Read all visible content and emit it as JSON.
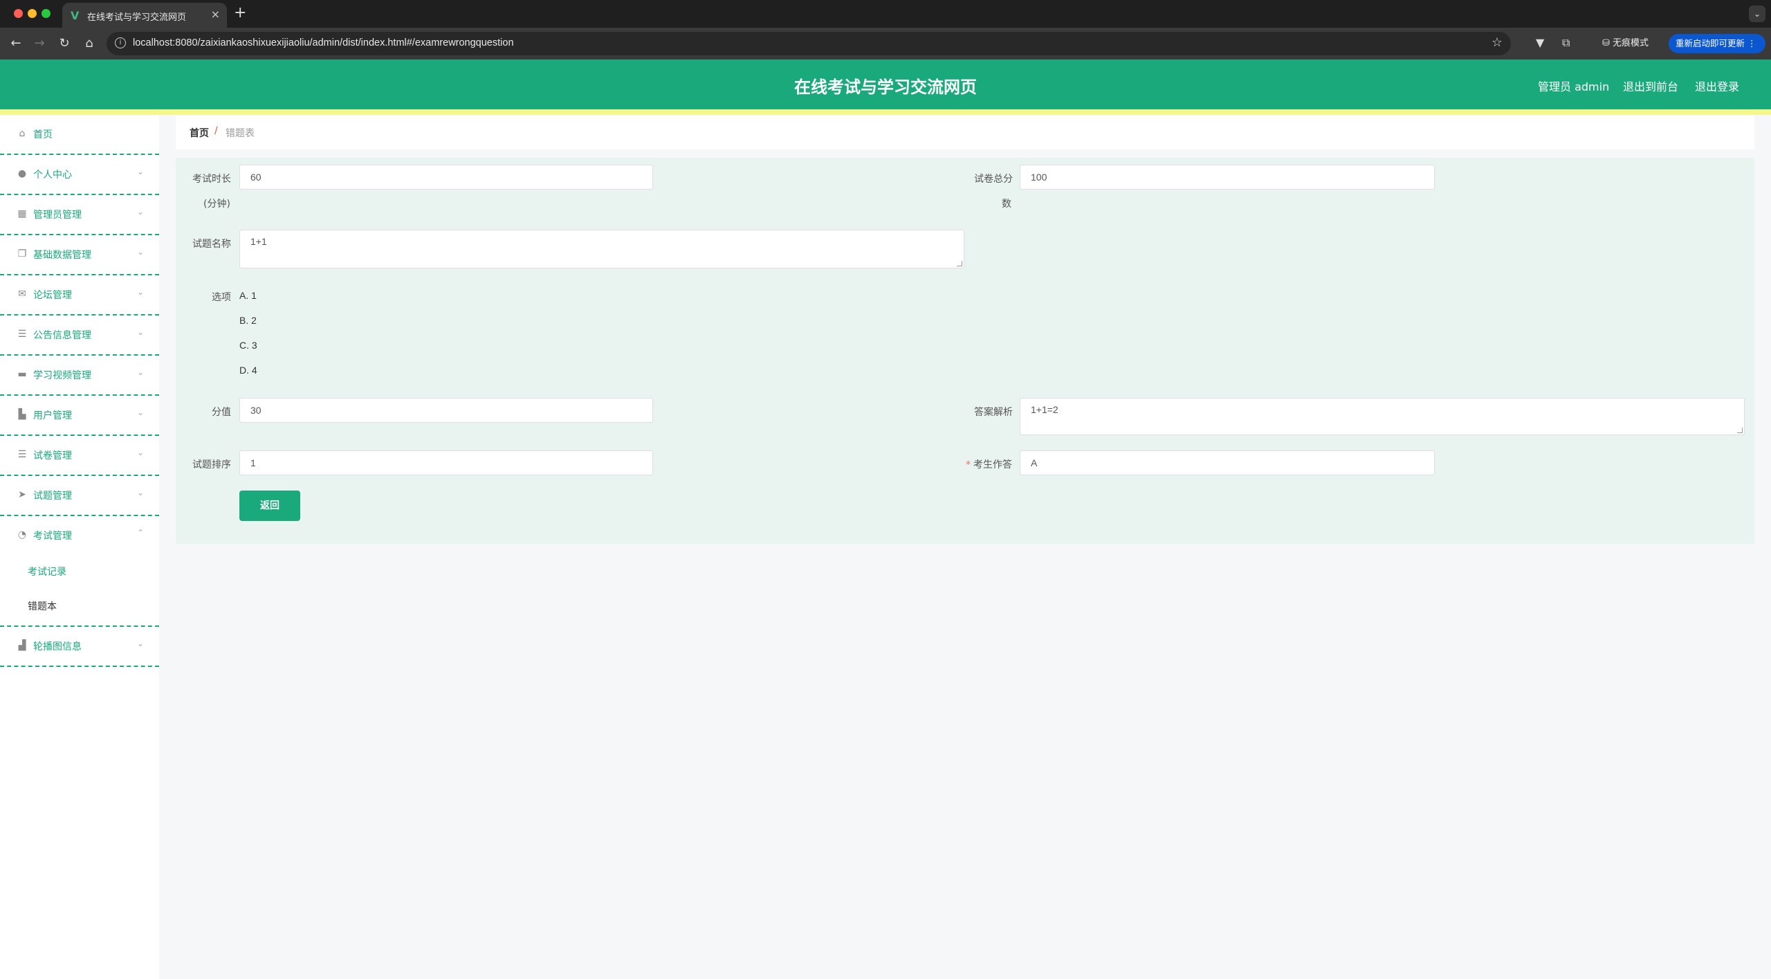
{
  "browser": {
    "tab_title": "在线考试与学习交流网页",
    "url": "localhost:8080/zaixiankaoshixuexijiaoliu/admin/dist/index.html#/examrewrongquestion",
    "incognito_label": "无痕模式",
    "update_label": "重新启动即可更新"
  },
  "header": {
    "title": "在线考试与学习交流网页",
    "user_label": "管理员 admin",
    "front_link": "退出到前台",
    "logout_link": "退出登录"
  },
  "sidebar": {
    "items": [
      {
        "label": "首页",
        "icon": "home-icon"
      },
      {
        "label": "个人中心",
        "icon": "user-icon"
      },
      {
        "label": "管理员管理",
        "icon": "grid-icon"
      },
      {
        "label": "基础数据管理",
        "icon": "copy-icon"
      },
      {
        "label": "论坛管理",
        "icon": "mail-icon"
      },
      {
        "label": "公告信息管理",
        "icon": "list-icon"
      },
      {
        "label": "学习视频管理",
        "icon": "monitor-icon"
      },
      {
        "label": "用户管理",
        "icon": "users-icon"
      },
      {
        "label": "试卷管理",
        "icon": "list-icon"
      },
      {
        "label": "试题管理",
        "icon": "send-icon"
      },
      {
        "label": "考试管理",
        "icon": "gauge-icon"
      },
      {
        "label": "轮播图信息",
        "icon": "bar-chart-icon"
      }
    ],
    "sub_items": [
      "考试记录",
      "错题本"
    ]
  },
  "breadcrumb": {
    "home": "首页",
    "separator": "/",
    "current": "错题表"
  },
  "form": {
    "duration_label_1": "考试时长",
    "duration_label_2": "(分钟)",
    "duration_value": "60",
    "total_label_1": "试卷总分",
    "total_label_2": "数",
    "total_value": "100",
    "question_name_label": "试题名称",
    "question_name_value": "1+1",
    "options_label": "选项",
    "options": [
      "A. 1",
      "B. 2",
      "C. 3",
      "D. 4"
    ],
    "score_label": "分值",
    "score_value": "30",
    "analysis_label": "答案解析",
    "analysis_value": "1+1=2",
    "order_label": "试题排序",
    "order_value": "1",
    "answer_required": "*",
    "answer_label": "考生作答",
    "answer_value": "A",
    "back_button": "返回"
  },
  "colors": {
    "primary": "#1aa97a",
    "accent_stripe": "#f5f78a",
    "panel_bg": "#e9f3ef"
  }
}
